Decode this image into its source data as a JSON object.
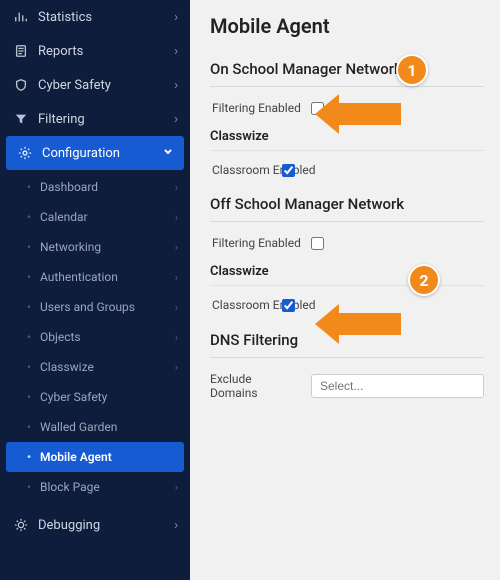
{
  "sidebar": {
    "top": [
      {
        "label": "Statistics",
        "icon": "stats"
      },
      {
        "label": "Reports",
        "icon": "reports"
      },
      {
        "label": "Cyber Safety",
        "icon": "shield"
      },
      {
        "label": "Filtering",
        "icon": "filter"
      }
    ],
    "configuration_label": "Configuration",
    "config_items": [
      {
        "label": "Dashboard",
        "chev": true
      },
      {
        "label": "Calendar",
        "chev": true
      },
      {
        "label": "Networking",
        "chev": true
      },
      {
        "label": "Authentication",
        "chev": true
      },
      {
        "label": "Users and Groups",
        "chev": true
      },
      {
        "label": "Objects",
        "chev": true
      },
      {
        "label": "Classwize",
        "chev": true
      },
      {
        "label": "Cyber Safety",
        "chev": false
      },
      {
        "label": "Walled Garden",
        "chev": false
      },
      {
        "label": "Mobile Agent",
        "chev": false,
        "selected": true
      },
      {
        "label": "Block Page",
        "chev": true
      }
    ],
    "debugging_label": "Debugging"
  },
  "page": {
    "title": "Mobile Agent",
    "on_network_title": "On School Manager Network",
    "off_network_title": "Off School Manager Network",
    "filtering_enabled_label": "Filtering Enabled",
    "classwize_heading": "Classwize",
    "classroom_enabled_label": "Classroom\nEnabled",
    "dns_heading": "DNS Filtering",
    "exclude_label": "Exclude Domains",
    "exclude_placeholder": "Select..."
  },
  "callouts": {
    "badge1": "1",
    "badge2": "2"
  }
}
